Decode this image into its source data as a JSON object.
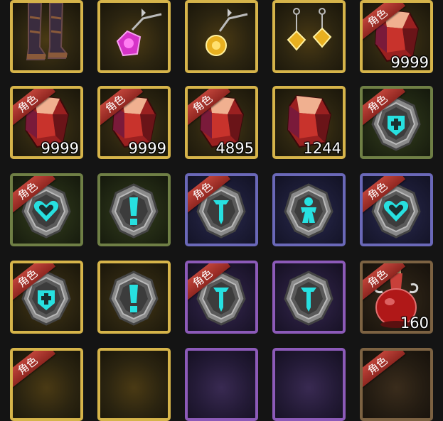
{
  "inventory": {
    "tag_label": "角色",
    "items": [
      {
        "icon": "boots-icon",
        "frame": "gold",
        "tag": false,
        "count": ""
      },
      {
        "icon": "pink-gem-necklace-icon",
        "frame": "gold",
        "tag": false,
        "count": ""
      },
      {
        "icon": "gold-gem-necklace-icon",
        "frame": "gold",
        "tag": false,
        "count": ""
      },
      {
        "icon": "gold-earrings-icon",
        "frame": "gold",
        "tag": false,
        "count": ""
      },
      {
        "icon": "red-crystal-icon",
        "frame": "gold",
        "tag": true,
        "count": "9999"
      },
      {
        "icon": "red-crystal-icon",
        "frame": "gold",
        "tag": true,
        "count": "9999"
      },
      {
        "icon": "red-crystal-icon",
        "frame": "gold",
        "tag": true,
        "count": "9999"
      },
      {
        "icon": "red-crystal-icon",
        "frame": "gold",
        "tag": true,
        "count": "4895"
      },
      {
        "icon": "red-crystal-icon",
        "frame": "gold",
        "tag": false,
        "count": "1244"
      },
      {
        "icon": "cross-shield-emblem-icon",
        "frame": "green",
        "tag": true,
        "count": ""
      },
      {
        "icon": "heart-emblem-icon",
        "frame": "green",
        "tag": true,
        "count": ""
      },
      {
        "icon": "exclamation-emblem-icon",
        "frame": "green",
        "tag": false,
        "count": ""
      },
      {
        "icon": "sword-emblem-icon",
        "frame": "blue",
        "tag": true,
        "count": ""
      },
      {
        "icon": "figure-emblem-icon",
        "frame": "blue",
        "tag": false,
        "count": ""
      },
      {
        "icon": "heart-emblem-icon",
        "frame": "blue",
        "tag": true,
        "count": ""
      },
      {
        "icon": "cross-shield-emblem-icon",
        "frame": "gold",
        "tag": true,
        "count": ""
      },
      {
        "icon": "exclamation-emblem-icon",
        "frame": "gold",
        "tag": false,
        "count": ""
      },
      {
        "icon": "sword-emblem-icon",
        "frame": "purple",
        "tag": true,
        "count": ""
      },
      {
        "icon": "sword-emblem-icon",
        "frame": "purple",
        "tag": false,
        "count": ""
      },
      {
        "icon": "red-potion-icon",
        "frame": "bronze",
        "tag": true,
        "count": "160"
      },
      {
        "icon": "",
        "frame": "gold",
        "tag": true,
        "count": ""
      },
      {
        "icon": "",
        "frame": "gold",
        "tag": false,
        "count": ""
      },
      {
        "icon": "",
        "frame": "purple",
        "tag": false,
        "count": ""
      },
      {
        "icon": "",
        "frame": "purple",
        "tag": false,
        "count": ""
      },
      {
        "icon": "",
        "frame": "bronze",
        "tag": true,
        "count": ""
      }
    ]
  }
}
